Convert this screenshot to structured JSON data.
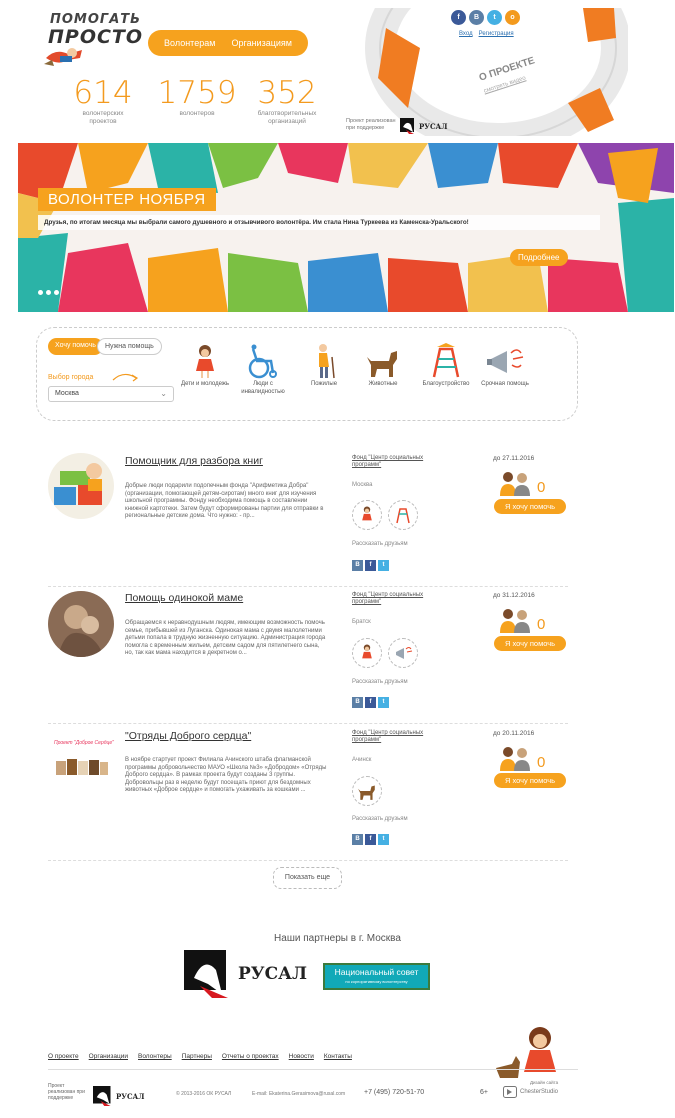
{
  "header": {
    "logo_line1": "ПОМОГАТЬ",
    "logo_line2": "ПРОСТО",
    "nav": [
      "Волонтерам",
      "Организациям"
    ],
    "social": [
      {
        "icon": "facebook-icon",
        "glyph": "f",
        "color": "#3b5998"
      },
      {
        "icon": "vk-icon",
        "glyph": "В",
        "color": "#5b7fa6"
      },
      {
        "icon": "twitter-icon",
        "glyph": "t",
        "color": "#45b0e3"
      },
      {
        "icon": "odnoklassniki-icon",
        "glyph": "o",
        "color": "#f39a1e"
      }
    ],
    "login": "Вход",
    "register": "Регистрация",
    "about_line1": "О ПРОЕКТЕ",
    "about_line2": "смотреть видео",
    "support_text": "Проект реализован при поддержке",
    "support_logo": "РУСАЛ"
  },
  "stats": [
    {
      "value": "614",
      "label": "волонтерских проектов"
    },
    {
      "value": "1759",
      "label": "волонтеров"
    },
    {
      "value": "352",
      "label": "благотворительных организаций"
    }
  ],
  "banner": {
    "title": "ВОЛОНТЕР НОЯБРЯ",
    "text": "Друзья, по итогам месяца мы выбрали самого душевного и отзывчивого волонтёра. Им стала Нина Туркеева из Каменска-Уральского!",
    "more": "Подробнее"
  },
  "filter": {
    "tab_active": "Хочу помочь",
    "tab_inactive": "Нужна помощь",
    "city_label": "Выбор города",
    "city_value": "Москва",
    "categories": [
      {
        "label": "Дети и молодежь",
        "icon": "child-icon"
      },
      {
        "label": "Люди с инвалидностью",
        "icon": "wheelchair-icon"
      },
      {
        "label": "Пожилые",
        "icon": "elderly-icon"
      },
      {
        "label": "Животные",
        "icon": "dog-icon"
      },
      {
        "label": "Благоустройство",
        "icon": "playground-icon"
      },
      {
        "label": "Срочная помощь",
        "icon": "megaphone-icon"
      }
    ]
  },
  "cards": [
    {
      "title": "Помощник для разбора книг",
      "text": "Добрые люди подарили подопечным фонда \"Арифметика Добра\" (организации, помогающей детям-сиротам) много книг для изучения школьной программы. Фонду необходима помощь в составлении книжной картотеки. Затем будут сформированы партии для отправки в региональные детские дома. Что нужно: - пр...",
      "org": "Фонд \"Центр социальных программ\"",
      "city": "Москва",
      "share": "Рассказать друзьям",
      "date": "до 27.11.2016",
      "count": "0",
      "button": "Я хочу помочь"
    },
    {
      "title": "Помощь одинокой маме",
      "text": "Обращаемся к неравнодушным людям, имеющим возможность помочь семье, прибывшей из Луганска. Одинокая мама с двумя малолетними детьми попала в трудную жизненную ситуацию. Администрация города помогла с временным жильем, детским садом для пятилетнего сына, но, так как мама находится в декретном о...",
      "org": "Фонд \"Центр социальных программ\"",
      "city": "Братск",
      "share": "Рассказать друзьям",
      "date": "до 31.12.2016",
      "count": "0",
      "button": "Я хочу помочь"
    },
    {
      "title": "\"Отряды Доброго сердца\"",
      "text": "В ноябре стартует проект Филиала Ачинского штаба флагманской программы добровольчество МАУО «Школа №3» «Добродом» «Отряды Доброго сердца». В рамках проекта будут созданы 3 группы. Добровольцы раз в неделю будут посещать приют для бездомных животных «Доброе сердце» и помогать ухаживать за кошками ...",
      "org": "Фонд \"Центр социальных программ\"",
      "city": "Ачинск",
      "share": "Рассказать друзьям",
      "date": "до 20.11.2016",
      "count": "0",
      "button": "Я хочу помочь",
      "thumb_caption": "Проект \"Доброе Сердце\""
    }
  ],
  "show_more": "Показать еще",
  "partners": {
    "title": "Наши партнеры в г. Москва",
    "rusal": "РУСАЛ",
    "natsovet_line1": "Национальный совет",
    "natsovet_line2": "по корпоративному волонтерству"
  },
  "footer": {
    "links": [
      "О проекте",
      "Организации",
      "Волонтеры",
      "Партнеры",
      "Отчеты о проектах",
      "Новости",
      "Контакты"
    ],
    "support": "Проект реализован при поддержке",
    "logo": "РУСАЛ",
    "copyright": "© 2013-2016 ОК РУСАЛ",
    "email": "E-mail: Ekaterina.Gerasimova@rusal.com",
    "phone": "+7 (495) 720-51-70",
    "age": "6+",
    "design_line1": "Дизайн сайта",
    "design_line2": "ChesterStudio"
  }
}
